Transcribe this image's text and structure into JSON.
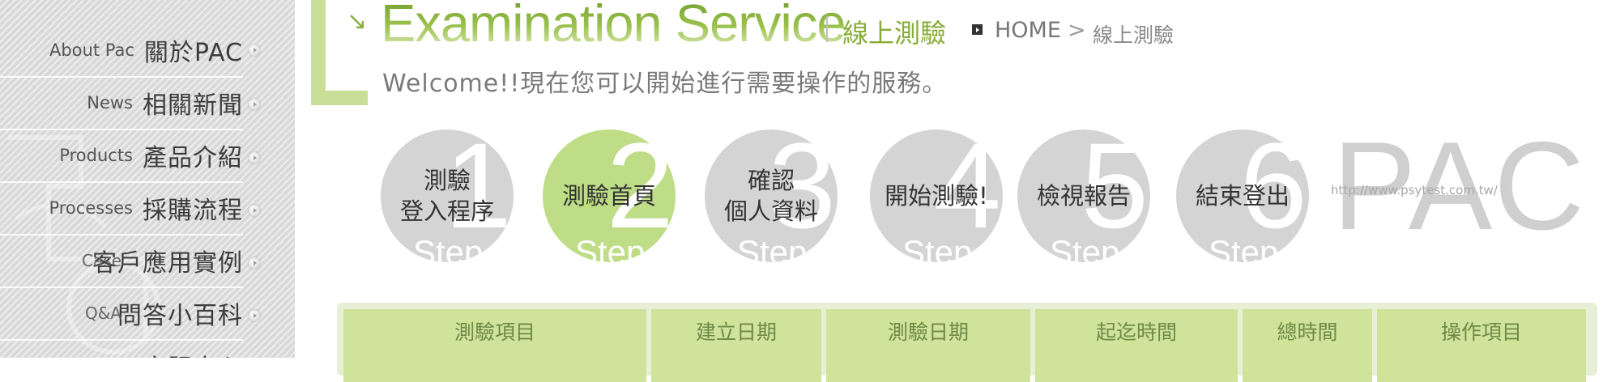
{
  "nav": {
    "items": [
      {
        "en": "About Pac",
        "zh": "關於PAC"
      },
      {
        "en": "News",
        "zh": "相關新聞"
      },
      {
        "en": "Products",
        "zh": "產品介紹"
      },
      {
        "en": "Processes",
        "zh": "採購流程"
      },
      {
        "en": "Case",
        "zh": "客戶應用實例"
      },
      {
        "en": "Q&A",
        "zh": "問答小百科"
      },
      {
        "en": "",
        "zh": "客服中心"
      }
    ]
  },
  "header": {
    "title_en": "Examination Service",
    "title_zh": "線上測驗",
    "breadcrumb": {
      "home": "HOME",
      "separator": ">",
      "current": "線上測驗"
    },
    "welcome": "Welcome!!現在您可以開始進行需要操作的服務。"
  },
  "steps": {
    "step_word": "Step",
    "active_index": 2,
    "items": [
      {
        "number": "1",
        "label": "測驗\n登入程序"
      },
      {
        "number": "2",
        "label": "測驗首頁"
      },
      {
        "number": "3",
        "label": "確認\n個人資料"
      },
      {
        "number": "4",
        "label": "開始測驗!"
      },
      {
        "number": "5",
        "label": "檢視報告"
      },
      {
        "number": "6",
        "label": "結束登出"
      }
    ]
  },
  "brand": {
    "url": "http://www.psytest.com.tw/",
    "logo": "PAC"
  },
  "table": {
    "headers": [
      "測驗項目",
      "建立日期",
      "測驗日期",
      "起迄時間",
      "總時間",
      "操作項目"
    ]
  },
  "colors": {
    "accent": "#86ad35",
    "active_step": "#bedd86",
    "table_header": "#cfe39a",
    "inactive_step": "#d4d4d4"
  }
}
